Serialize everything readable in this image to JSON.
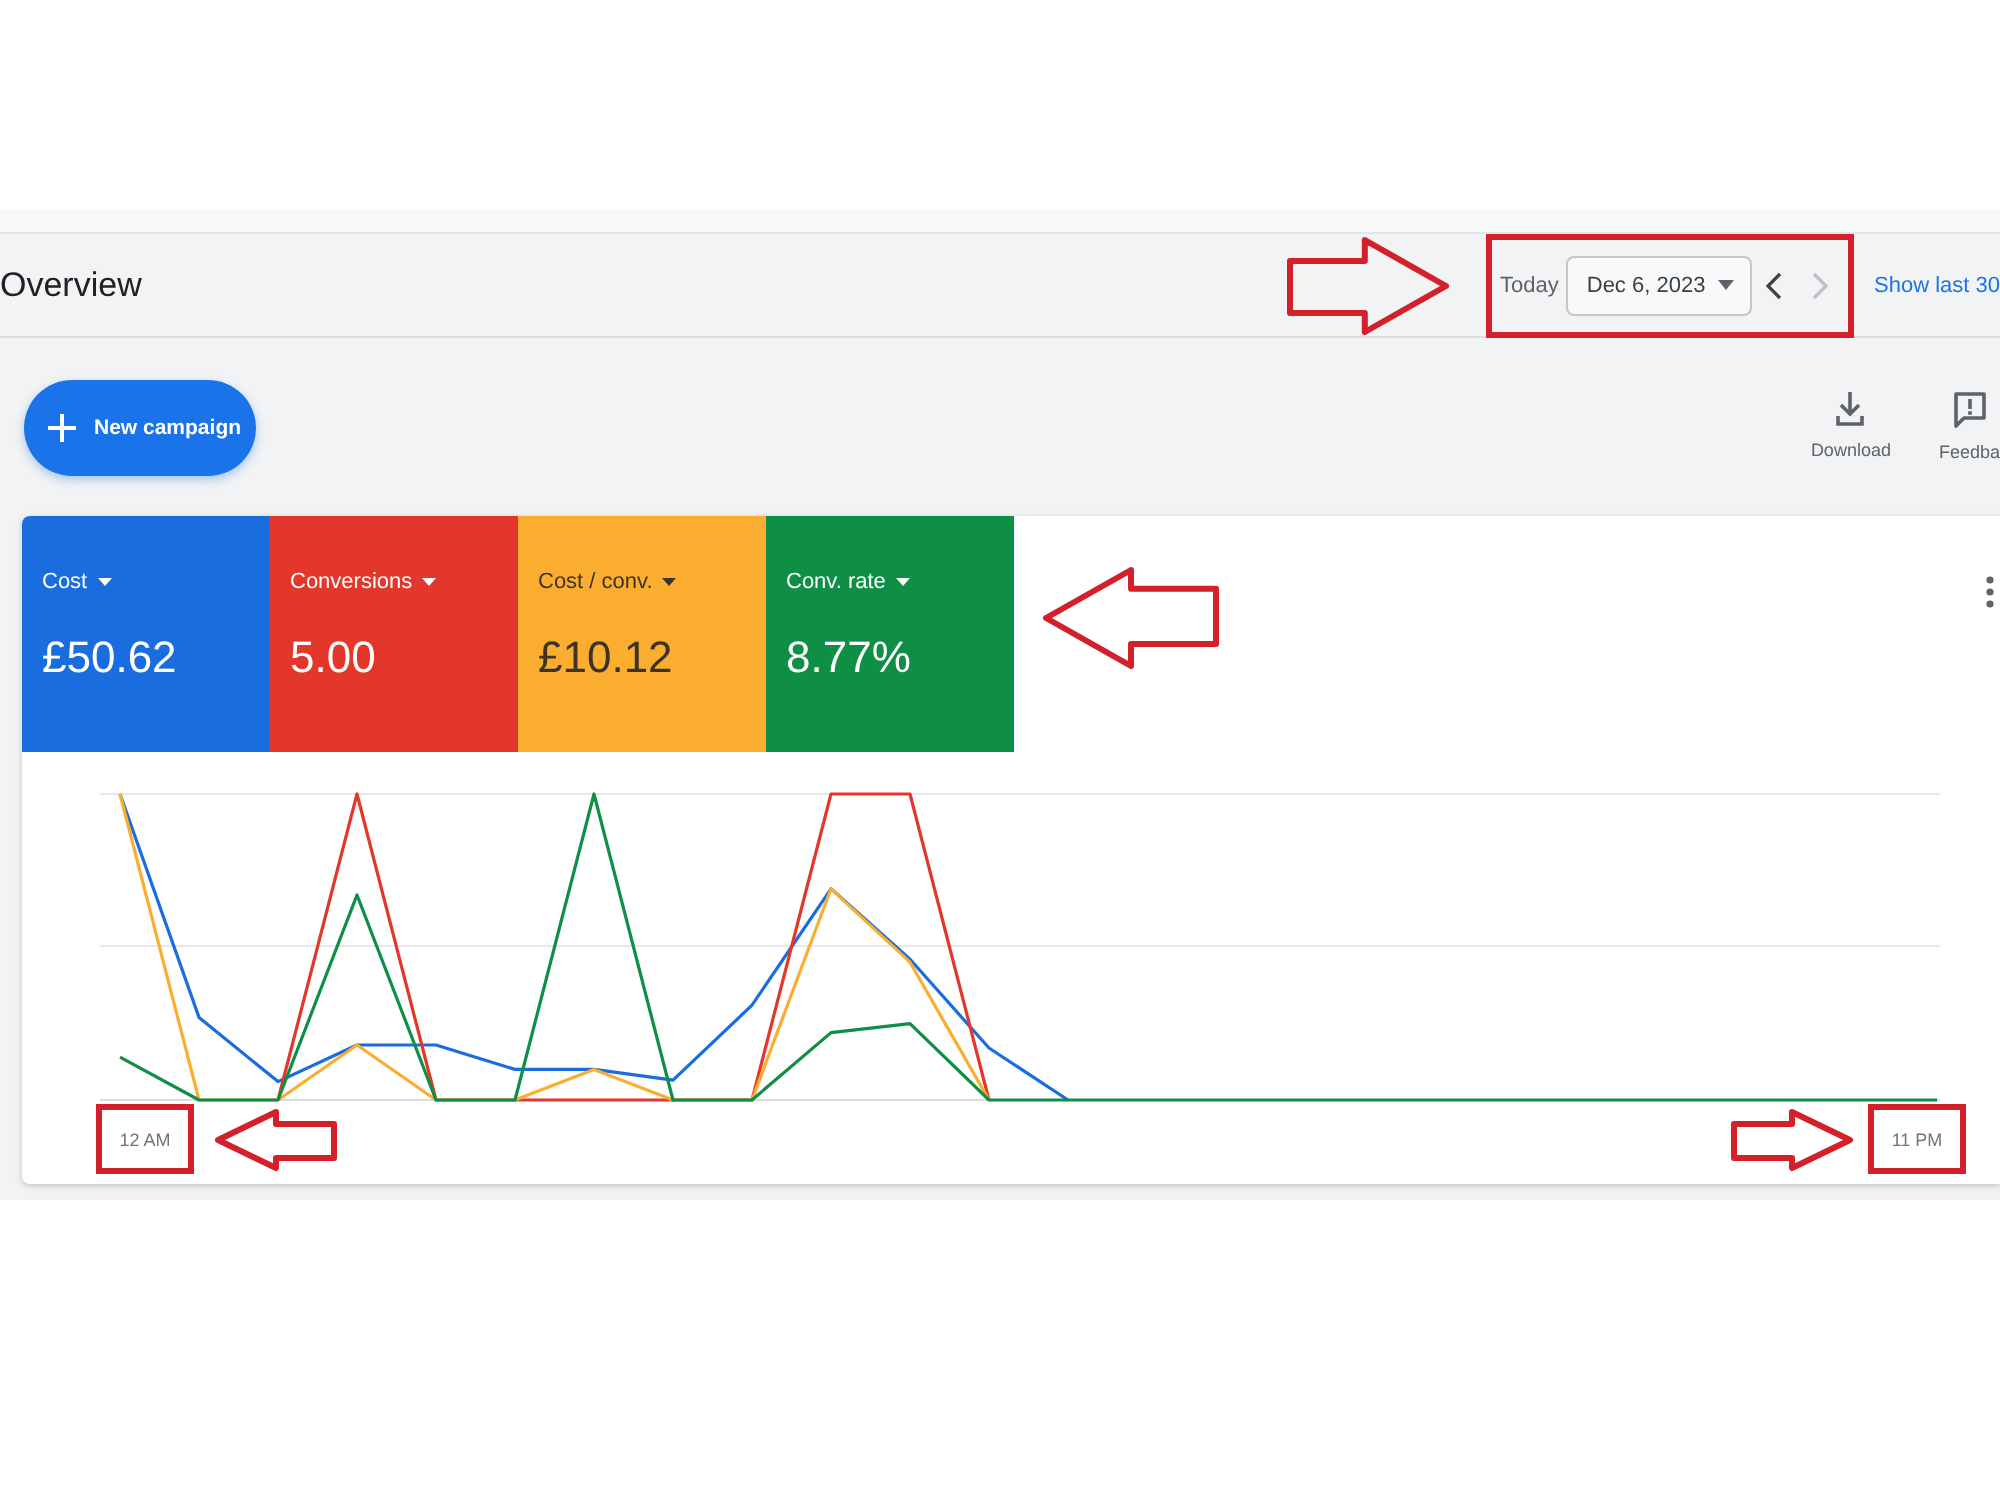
{
  "header": {
    "title": "Overview",
    "date_range": {
      "label": "Today",
      "value": "Dec 6, 2023",
      "previous": {
        "disabled": false
      },
      "next": {
        "disabled": true
      },
      "highlighted": true
    },
    "link": "Show last 30"
  },
  "toolbar": {
    "new_button": {
      "label": "New campaign"
    },
    "actions": [
      {
        "kind": "download",
        "label": "Download"
      },
      {
        "kind": "feedback",
        "label": "Feedba"
      }
    ]
  },
  "metrics": {
    "highlighted": true,
    "items": [
      {
        "label": "Cost",
        "value": "£50.62",
        "color": "#1a6ddf"
      },
      {
        "label": "Conversions",
        "value": "5.00",
        "color": "#e3372c"
      },
      {
        "label": "Cost / conv.",
        "value": "£10.12",
        "color": "#fbad30"
      },
      {
        "label": "Conv. rate",
        "value": "8.77%",
        "color": "#0f8f45"
      }
    ]
  },
  "chart": {
    "x_labels": [
      {
        "label": "12 AM",
        "highlighted": true
      },
      {
        "label": "11 PM",
        "highlighted": true
      }
    ]
  }
}
